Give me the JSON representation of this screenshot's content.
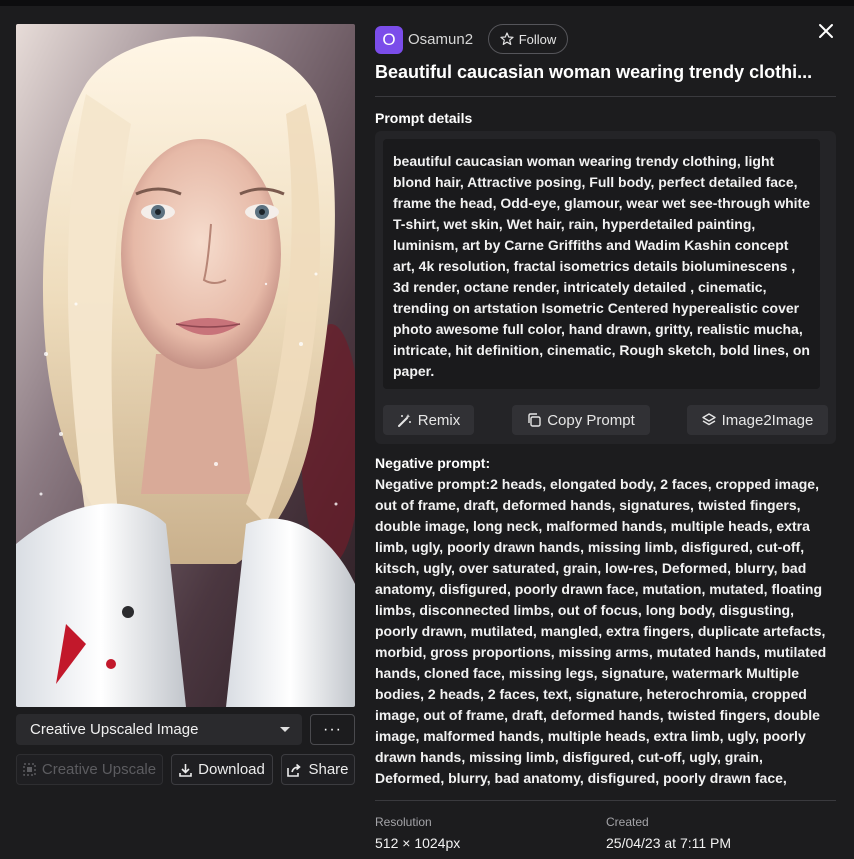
{
  "user": {
    "initial": "O",
    "name": "Osamun2",
    "follow_label": "Follow",
    "avatar_color": "#7b4dea"
  },
  "title": "Beautiful caucasian woman wearing trendy clothi...",
  "prompt": {
    "heading": "Prompt details",
    "text": "beautiful caucasian woman wearing trendy clothing, light blond hair, Attractive posing, Full body, perfect detailed face, frame the head, Odd-eye, glamour, wear wet see-through white T-shirt, wet skin, Wet hair, rain, hyperdetailed painting, luminism, art by Carne Griffiths and Wadim Kashin concept art, 4k resolution, fractal isometrics details bioluminescens , 3d render, octane render, intricately detailed , cinematic, trending on artstation Isometric Centered hyperealistic cover photo awesome full color, hand drawn, gritty, realistic mucha, intricate, hit definition, cinematic, Rough sketch, bold lines, on paper.",
    "remix_label": "Remix",
    "copy_label": "Copy Prompt",
    "image2image_label": "Image2Image"
  },
  "negative": {
    "heading": "Negative prompt:",
    "text": "Negative prompt:2 heads, elongated body, 2 faces, cropped image, out of frame, draft, deformed hands, signatures, twisted fingers, double image, long neck, malformed hands, multiple heads, extra limb, ugly, poorly drawn hands, missing limb, disfigured, cut-off, kitsch, ugly, over saturated, grain, low-res, Deformed, blurry, bad anatomy, disfigured, poorly drawn face, mutation, mutated, floating limbs, disconnected limbs, out of focus, long body, disgusting, poorly drawn, mutilated, mangled, extra fingers, duplicate artefacts, morbid, gross proportions, missing arms, mutated hands, mutilated hands, cloned face, missing legs, signature, watermark Multiple bodies, 2 heads, 2 faces, text, signature, heterochromia, cropped image, out of frame, draft, deformed hands, twisted fingers, double image, malformed hands, multiple heads, extra limb, ugly, poorly drawn hands, missing limb, disfigured, cut-off, ugly, grain, Deformed, blurry, bad anatomy, disfigured, poorly drawn face,"
  },
  "image_controls": {
    "variant_selected": "Creative Upscaled Image",
    "more_label": "···",
    "upscale_label": "Creative Upscale",
    "download_label": "Download",
    "share_label": "Share"
  },
  "meta": {
    "resolution_label": "Resolution",
    "resolution_value": "512 × 1024px",
    "created_label": "Created",
    "created_value": "25/04/23 at 7:11 PM"
  },
  "icons": {
    "close": "close-icon",
    "star": "star-icon",
    "remix": "magic-wand-icon",
    "copy": "copy-icon",
    "image2image": "layers-icon",
    "upscale": "upscale-icon",
    "download": "download-icon",
    "share": "share-icon",
    "dropdown": "chevron-down-icon"
  }
}
